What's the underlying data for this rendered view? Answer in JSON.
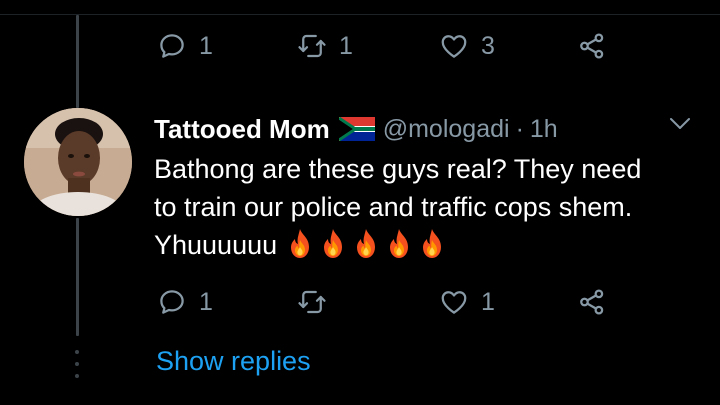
{
  "top_actions": {
    "reply_count": "1",
    "retweet_count": "1",
    "like_count": "3"
  },
  "tweet": {
    "display_name": "Tattooed Mom",
    "handle": "@mologadi",
    "separator": "·",
    "time": "1h",
    "text_lines": [
      "Bathong are these guys real? They need",
      "to train our police and traffic cops shem.",
      "Yhuuuuuu"
    ],
    "emoji_count": 5,
    "actions": {
      "reply_count": "1",
      "retweet_count": "",
      "like_count": "1"
    }
  },
  "show_replies_label": "Show replies",
  "colors": {
    "background": "#000000",
    "muted": "#8899a6",
    "accent": "#1da1f2",
    "thread_line": "#3d4449"
  },
  "icons": [
    "reply-icon",
    "retweet-icon",
    "like-icon",
    "share-icon",
    "chevron-down-icon",
    "south-africa-flag-icon",
    "fire-emoji-icon"
  ]
}
